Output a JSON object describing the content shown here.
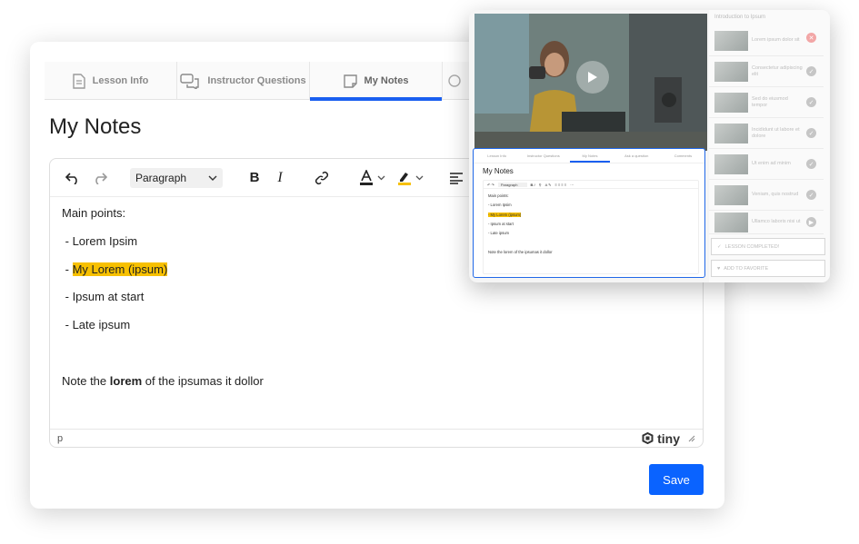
{
  "main": {
    "tabs": [
      {
        "label": "Lesson Info",
        "icon": "document-icon"
      },
      {
        "label": "Instructor Questions",
        "icon": "chat-bubbles-icon"
      },
      {
        "label": "My Notes",
        "icon": "note-icon",
        "active": true
      },
      {
        "label": "",
        "icon": "clock-icon"
      }
    ],
    "title": "My Notes",
    "editor": {
      "toolbar": {
        "paragraph_select": "Paragraph",
        "buttons": [
          "undo-icon",
          "redo-icon",
          "bold-icon",
          "italic-icon",
          "link-icon",
          "text-color-icon",
          "highlight-color-icon",
          "align-left-icon"
        ]
      },
      "content": {
        "heading": "Main points:",
        "items": [
          {
            "prefix": " - ",
            "text": "Lorem Ipsim",
            "highlight": false
          },
          {
            "prefix": " - ",
            "text": "My Lorem (ipsum)",
            "highlight": true
          },
          {
            "prefix": " - ",
            "text": "Ipsum at start",
            "highlight": false
          },
          {
            "prefix": " - ",
            "text": "Late ipsum",
            "highlight": false
          }
        ],
        "note_before": "Note the ",
        "note_bold": "lorem",
        "note_after": " of the ipsumas it dollor"
      },
      "status_path": "p",
      "brand": "tiny"
    },
    "save_label": "Save"
  },
  "overlay": {
    "mini": {
      "tabs": [
        "Lesson Info",
        "Instructor Questions",
        "My Notes",
        "Ask a question",
        "Comments"
      ],
      "title": "My Notes",
      "paragraph": "Paragraph",
      "lines": [
        "Main points:",
        "- Lorem Ipsim",
        "- My Lorem (ipsum)",
        "- Ipsum at start",
        "- Late ipsum",
        "",
        "Note the lorem of the ipsumas it dollor"
      ]
    },
    "sidebar": {
      "heading": "Introduction to Ipsum",
      "items": [
        {
          "label": "Lorem ipsum dolor sit",
          "status": "red"
        },
        {
          "label": "Consectetur adipiscing elit",
          "status": "done"
        },
        {
          "label": "Sed do eiusmod tempor",
          "status": "done"
        },
        {
          "label": "Incididunt ut labore et dolore",
          "status": "done"
        },
        {
          "label": "Ut enim ad minim",
          "status": "done"
        },
        {
          "label": "Veniam, quis nostrud",
          "status": "done"
        },
        {
          "label": "Ullamco laboris nisi ut",
          "status": "play"
        }
      ],
      "lesson_completed": "LESSON COMPLETED!",
      "add_to_favorite": "ADD TO FAVORITE"
    }
  },
  "colors": {
    "accent": "#0a63ff",
    "highlight": "#f7c000",
    "tab_active": "#1a5ff0"
  }
}
